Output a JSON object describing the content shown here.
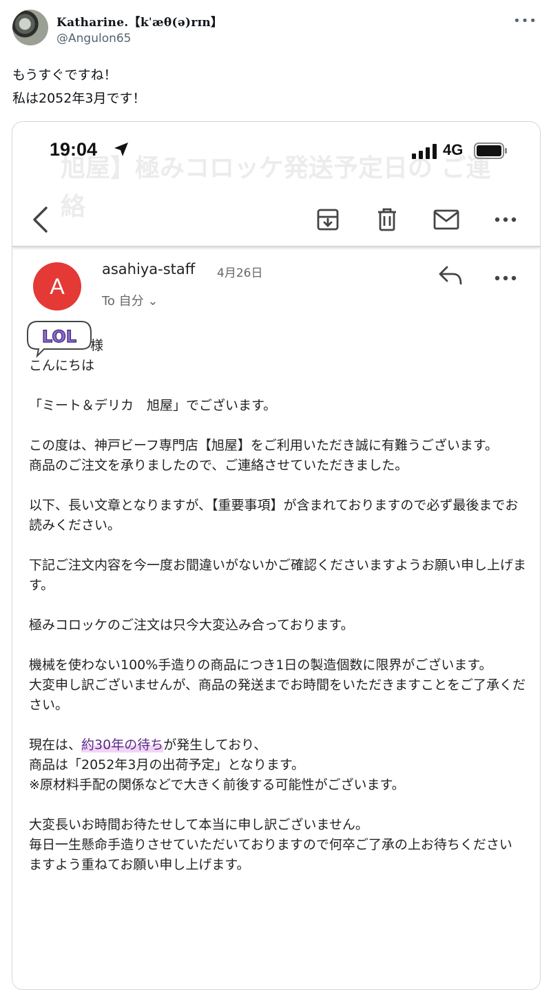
{
  "tweet": {
    "display_name": "𝐊atharine.【kˈæθ(ə)rɪn】",
    "handle": "@Angulon65",
    "more_icon": "more-horizontal-icon",
    "text_lines": [
      "もうすぐですね！",
      "私は2052年3月です！"
    ]
  },
  "phone": {
    "time": "19:04",
    "network": "4G",
    "ghost_subject": "旭屋】極みコロッケ発送予定日の ご連絡",
    "toolbar_icons": [
      "back-arrow-icon",
      "archive-icon",
      "trash-icon",
      "mail-icon",
      "more-horizontal-icon"
    ]
  },
  "email": {
    "avatar_letter": "A",
    "avatar_color": "#e53935",
    "sender": "asahiya-staff",
    "date": "4月26日",
    "to": "To 自分 ⌄",
    "sticker": "LOL",
    "salutation_suffix": "様",
    "greeting": "こんにちは",
    "paragraphs": [
      "「ミート＆デリカ　旭屋」でございます。",
      "この度は、神戸ビーフ専門店【旭屋】をご利用いただき誠に有難うございます。\n商品のご注文を承りましたので、ご連絡させていただきました。",
      "以下、長い文章となりますが、【重要事項】が含まれておりますので必ず最後までお読みください。",
      "下記ご注文内容を今一度お間違いがないかご確認くださいますようお願い申し上げます。",
      "極みコロッケのご注文は只今大変込み合っております。",
      "機械を使わない100%手造りの商品につき1日の製造個数に限界がございます。\n大変申し訳ございませんが、商品の発送までお時間をいただきますことをご了承ください。"
    ],
    "wait_prefix": "現在は、",
    "wait_highlight": "約30年の待ち",
    "wait_suffix": "が発生しており、",
    "ship_line": "商品は「2052年3月の出荷予定」となります。",
    "note_line": "※原材料手配の関係などで大きく前後する可能性がございます。",
    "closing": "大変長いお時間お待たせして本当に申し訳ございません。\n毎日一生懸命手造りさせていただいておりますので何卒ご了承の上お待ちください\nますよう重ねてお願い申し上げます。"
  }
}
